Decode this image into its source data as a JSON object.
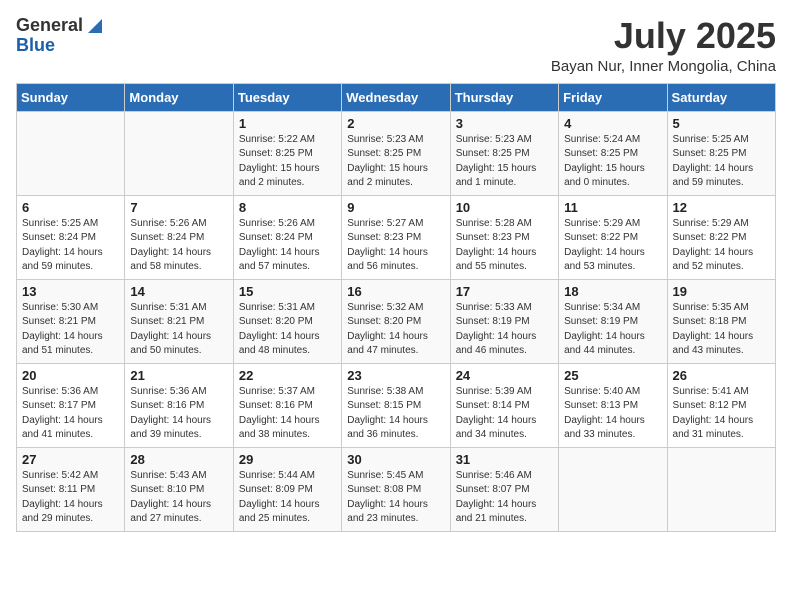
{
  "header": {
    "logo_general": "General",
    "logo_blue": "Blue",
    "month": "July 2025",
    "location": "Bayan Nur, Inner Mongolia, China"
  },
  "days_of_week": [
    "Sunday",
    "Monday",
    "Tuesday",
    "Wednesday",
    "Thursday",
    "Friday",
    "Saturday"
  ],
  "weeks": [
    [
      {
        "day": "",
        "info": ""
      },
      {
        "day": "",
        "info": ""
      },
      {
        "day": "1",
        "info": "Sunrise: 5:22 AM\nSunset: 8:25 PM\nDaylight: 15 hours\nand 2 minutes."
      },
      {
        "day": "2",
        "info": "Sunrise: 5:23 AM\nSunset: 8:25 PM\nDaylight: 15 hours\nand 2 minutes."
      },
      {
        "day": "3",
        "info": "Sunrise: 5:23 AM\nSunset: 8:25 PM\nDaylight: 15 hours\nand 1 minute."
      },
      {
        "day": "4",
        "info": "Sunrise: 5:24 AM\nSunset: 8:25 PM\nDaylight: 15 hours\nand 0 minutes."
      },
      {
        "day": "5",
        "info": "Sunrise: 5:25 AM\nSunset: 8:25 PM\nDaylight: 14 hours\nand 59 minutes."
      }
    ],
    [
      {
        "day": "6",
        "info": "Sunrise: 5:25 AM\nSunset: 8:24 PM\nDaylight: 14 hours\nand 59 minutes."
      },
      {
        "day": "7",
        "info": "Sunrise: 5:26 AM\nSunset: 8:24 PM\nDaylight: 14 hours\nand 58 minutes."
      },
      {
        "day": "8",
        "info": "Sunrise: 5:26 AM\nSunset: 8:24 PM\nDaylight: 14 hours\nand 57 minutes."
      },
      {
        "day": "9",
        "info": "Sunrise: 5:27 AM\nSunset: 8:23 PM\nDaylight: 14 hours\nand 56 minutes."
      },
      {
        "day": "10",
        "info": "Sunrise: 5:28 AM\nSunset: 8:23 PM\nDaylight: 14 hours\nand 55 minutes."
      },
      {
        "day": "11",
        "info": "Sunrise: 5:29 AM\nSunset: 8:22 PM\nDaylight: 14 hours\nand 53 minutes."
      },
      {
        "day": "12",
        "info": "Sunrise: 5:29 AM\nSunset: 8:22 PM\nDaylight: 14 hours\nand 52 minutes."
      }
    ],
    [
      {
        "day": "13",
        "info": "Sunrise: 5:30 AM\nSunset: 8:21 PM\nDaylight: 14 hours\nand 51 minutes."
      },
      {
        "day": "14",
        "info": "Sunrise: 5:31 AM\nSunset: 8:21 PM\nDaylight: 14 hours\nand 50 minutes."
      },
      {
        "day": "15",
        "info": "Sunrise: 5:31 AM\nSunset: 8:20 PM\nDaylight: 14 hours\nand 48 minutes."
      },
      {
        "day": "16",
        "info": "Sunrise: 5:32 AM\nSunset: 8:20 PM\nDaylight: 14 hours\nand 47 minutes."
      },
      {
        "day": "17",
        "info": "Sunrise: 5:33 AM\nSunset: 8:19 PM\nDaylight: 14 hours\nand 46 minutes."
      },
      {
        "day": "18",
        "info": "Sunrise: 5:34 AM\nSunset: 8:19 PM\nDaylight: 14 hours\nand 44 minutes."
      },
      {
        "day": "19",
        "info": "Sunrise: 5:35 AM\nSunset: 8:18 PM\nDaylight: 14 hours\nand 43 minutes."
      }
    ],
    [
      {
        "day": "20",
        "info": "Sunrise: 5:36 AM\nSunset: 8:17 PM\nDaylight: 14 hours\nand 41 minutes."
      },
      {
        "day": "21",
        "info": "Sunrise: 5:36 AM\nSunset: 8:16 PM\nDaylight: 14 hours\nand 39 minutes."
      },
      {
        "day": "22",
        "info": "Sunrise: 5:37 AM\nSunset: 8:16 PM\nDaylight: 14 hours\nand 38 minutes."
      },
      {
        "day": "23",
        "info": "Sunrise: 5:38 AM\nSunset: 8:15 PM\nDaylight: 14 hours\nand 36 minutes."
      },
      {
        "day": "24",
        "info": "Sunrise: 5:39 AM\nSunset: 8:14 PM\nDaylight: 14 hours\nand 34 minutes."
      },
      {
        "day": "25",
        "info": "Sunrise: 5:40 AM\nSunset: 8:13 PM\nDaylight: 14 hours\nand 33 minutes."
      },
      {
        "day": "26",
        "info": "Sunrise: 5:41 AM\nSunset: 8:12 PM\nDaylight: 14 hours\nand 31 minutes."
      }
    ],
    [
      {
        "day": "27",
        "info": "Sunrise: 5:42 AM\nSunset: 8:11 PM\nDaylight: 14 hours\nand 29 minutes."
      },
      {
        "day": "28",
        "info": "Sunrise: 5:43 AM\nSunset: 8:10 PM\nDaylight: 14 hours\nand 27 minutes."
      },
      {
        "day": "29",
        "info": "Sunrise: 5:44 AM\nSunset: 8:09 PM\nDaylight: 14 hours\nand 25 minutes."
      },
      {
        "day": "30",
        "info": "Sunrise: 5:45 AM\nSunset: 8:08 PM\nDaylight: 14 hours\nand 23 minutes."
      },
      {
        "day": "31",
        "info": "Sunrise: 5:46 AM\nSunset: 8:07 PM\nDaylight: 14 hours\nand 21 minutes."
      },
      {
        "day": "",
        "info": ""
      },
      {
        "day": "",
        "info": ""
      }
    ]
  ]
}
